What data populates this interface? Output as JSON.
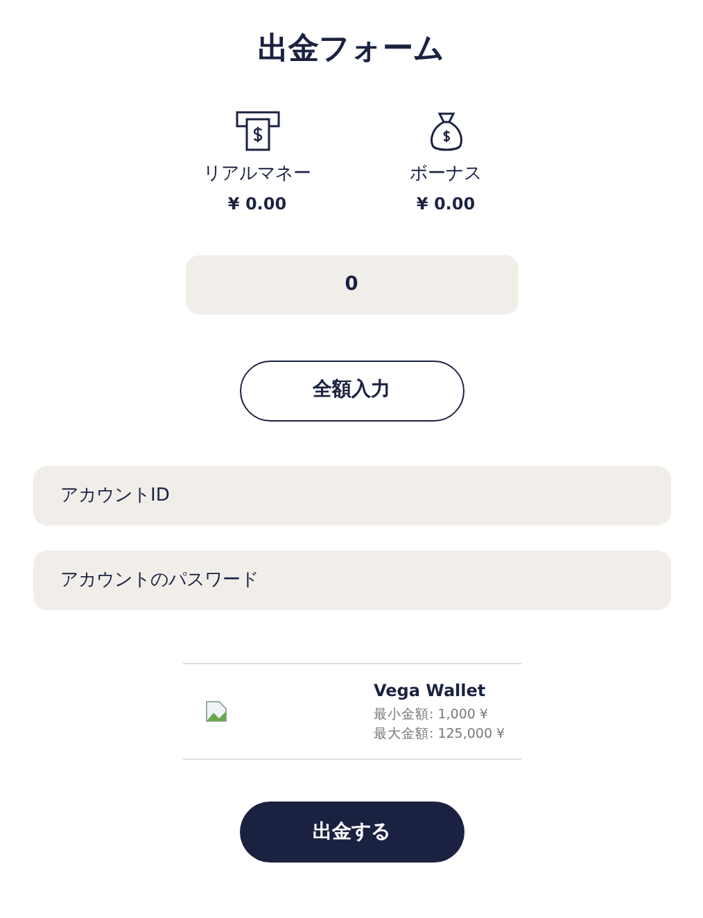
{
  "title": "出金フォーム",
  "balances": [
    {
      "kind": "atm",
      "label": "リアルマネー",
      "amount": "¥ 0.00"
    },
    {
      "kind": "bag",
      "label": "ボーナス",
      "amount": "¥ 0.00"
    }
  ],
  "amount_field": {
    "value": "0"
  },
  "fill_all_button": "全額入力",
  "fields": [
    {
      "placeholder": "アカウントID"
    },
    {
      "placeholder": "アカウントのパスワード"
    }
  ],
  "method": {
    "name": "Vega Wallet",
    "min": "最小金額: 1,000 ¥",
    "max": "最大金額: 125,000 ¥"
  },
  "submit_button": "出金する"
}
